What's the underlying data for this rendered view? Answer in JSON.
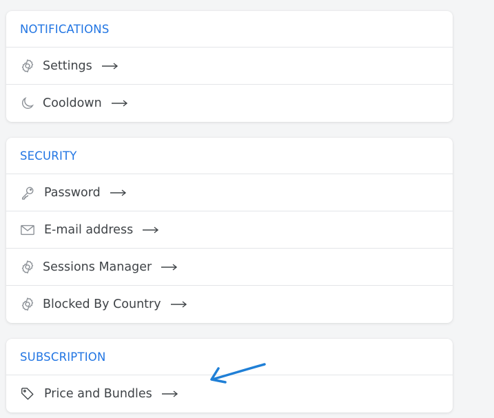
{
  "sections": [
    {
      "title": "NOTIFICATIONS",
      "items": [
        {
          "label": "Settings",
          "icon": "gear-icon"
        },
        {
          "label": "Cooldown",
          "icon": "moon-icon"
        }
      ]
    },
    {
      "title": "SECURITY",
      "items": [
        {
          "label": "Password",
          "icon": "key-icon"
        },
        {
          "label": "E-mail address",
          "icon": "mail-icon"
        },
        {
          "label": "Sessions Manager",
          "icon": "gear-icon"
        },
        {
          "label": "Blocked By Country",
          "icon": "gear-icon"
        }
      ]
    },
    {
      "title": "SUBSCRIPTION",
      "items": [
        {
          "label": "Price and Bundles",
          "icon": "tag-icon"
        }
      ]
    }
  ],
  "colors": {
    "accent": "#2175e3",
    "text": "#3f4347",
    "icon": "#8a8f95",
    "annotation_arrow": "#1f7fd6"
  }
}
